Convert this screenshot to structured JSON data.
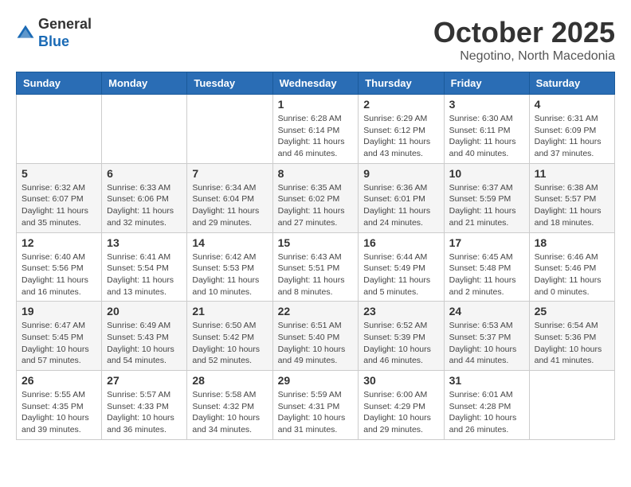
{
  "logo": {
    "general": "General",
    "blue": "Blue"
  },
  "title": "October 2025",
  "location": "Negotino, North Macedonia",
  "weekdays": [
    "Sunday",
    "Monday",
    "Tuesday",
    "Wednesday",
    "Thursday",
    "Friday",
    "Saturday"
  ],
  "weeks": [
    [
      {
        "day": "",
        "info": ""
      },
      {
        "day": "",
        "info": ""
      },
      {
        "day": "",
        "info": ""
      },
      {
        "day": "1",
        "info": "Sunrise: 6:28 AM\nSunset: 6:14 PM\nDaylight: 11 hours\nand 46 minutes."
      },
      {
        "day": "2",
        "info": "Sunrise: 6:29 AM\nSunset: 6:12 PM\nDaylight: 11 hours\nand 43 minutes."
      },
      {
        "day": "3",
        "info": "Sunrise: 6:30 AM\nSunset: 6:11 PM\nDaylight: 11 hours\nand 40 minutes."
      },
      {
        "day": "4",
        "info": "Sunrise: 6:31 AM\nSunset: 6:09 PM\nDaylight: 11 hours\nand 37 minutes."
      }
    ],
    [
      {
        "day": "5",
        "info": "Sunrise: 6:32 AM\nSunset: 6:07 PM\nDaylight: 11 hours\nand 35 minutes."
      },
      {
        "day": "6",
        "info": "Sunrise: 6:33 AM\nSunset: 6:06 PM\nDaylight: 11 hours\nand 32 minutes."
      },
      {
        "day": "7",
        "info": "Sunrise: 6:34 AM\nSunset: 6:04 PM\nDaylight: 11 hours\nand 29 minutes."
      },
      {
        "day": "8",
        "info": "Sunrise: 6:35 AM\nSunset: 6:02 PM\nDaylight: 11 hours\nand 27 minutes."
      },
      {
        "day": "9",
        "info": "Sunrise: 6:36 AM\nSunset: 6:01 PM\nDaylight: 11 hours\nand 24 minutes."
      },
      {
        "day": "10",
        "info": "Sunrise: 6:37 AM\nSunset: 5:59 PM\nDaylight: 11 hours\nand 21 minutes."
      },
      {
        "day": "11",
        "info": "Sunrise: 6:38 AM\nSunset: 5:57 PM\nDaylight: 11 hours\nand 18 minutes."
      }
    ],
    [
      {
        "day": "12",
        "info": "Sunrise: 6:40 AM\nSunset: 5:56 PM\nDaylight: 11 hours\nand 16 minutes."
      },
      {
        "day": "13",
        "info": "Sunrise: 6:41 AM\nSunset: 5:54 PM\nDaylight: 11 hours\nand 13 minutes."
      },
      {
        "day": "14",
        "info": "Sunrise: 6:42 AM\nSunset: 5:53 PM\nDaylight: 11 hours\nand 10 minutes."
      },
      {
        "day": "15",
        "info": "Sunrise: 6:43 AM\nSunset: 5:51 PM\nDaylight: 11 hours\nand 8 minutes."
      },
      {
        "day": "16",
        "info": "Sunrise: 6:44 AM\nSunset: 5:49 PM\nDaylight: 11 hours\nand 5 minutes."
      },
      {
        "day": "17",
        "info": "Sunrise: 6:45 AM\nSunset: 5:48 PM\nDaylight: 11 hours\nand 2 minutes."
      },
      {
        "day": "18",
        "info": "Sunrise: 6:46 AM\nSunset: 5:46 PM\nDaylight: 11 hours\nand 0 minutes."
      }
    ],
    [
      {
        "day": "19",
        "info": "Sunrise: 6:47 AM\nSunset: 5:45 PM\nDaylight: 10 hours\nand 57 minutes."
      },
      {
        "day": "20",
        "info": "Sunrise: 6:49 AM\nSunset: 5:43 PM\nDaylight: 10 hours\nand 54 minutes."
      },
      {
        "day": "21",
        "info": "Sunrise: 6:50 AM\nSunset: 5:42 PM\nDaylight: 10 hours\nand 52 minutes."
      },
      {
        "day": "22",
        "info": "Sunrise: 6:51 AM\nSunset: 5:40 PM\nDaylight: 10 hours\nand 49 minutes."
      },
      {
        "day": "23",
        "info": "Sunrise: 6:52 AM\nSunset: 5:39 PM\nDaylight: 10 hours\nand 46 minutes."
      },
      {
        "day": "24",
        "info": "Sunrise: 6:53 AM\nSunset: 5:37 PM\nDaylight: 10 hours\nand 44 minutes."
      },
      {
        "day": "25",
        "info": "Sunrise: 6:54 AM\nSunset: 5:36 PM\nDaylight: 10 hours\nand 41 minutes."
      }
    ],
    [
      {
        "day": "26",
        "info": "Sunrise: 5:55 AM\nSunset: 4:35 PM\nDaylight: 10 hours\nand 39 minutes."
      },
      {
        "day": "27",
        "info": "Sunrise: 5:57 AM\nSunset: 4:33 PM\nDaylight: 10 hours\nand 36 minutes."
      },
      {
        "day": "28",
        "info": "Sunrise: 5:58 AM\nSunset: 4:32 PM\nDaylight: 10 hours\nand 34 minutes."
      },
      {
        "day": "29",
        "info": "Sunrise: 5:59 AM\nSunset: 4:31 PM\nDaylight: 10 hours\nand 31 minutes."
      },
      {
        "day": "30",
        "info": "Sunrise: 6:00 AM\nSunset: 4:29 PM\nDaylight: 10 hours\nand 29 minutes."
      },
      {
        "day": "31",
        "info": "Sunrise: 6:01 AM\nSunset: 4:28 PM\nDaylight: 10 hours\nand 26 minutes."
      },
      {
        "day": "",
        "info": ""
      }
    ]
  ]
}
